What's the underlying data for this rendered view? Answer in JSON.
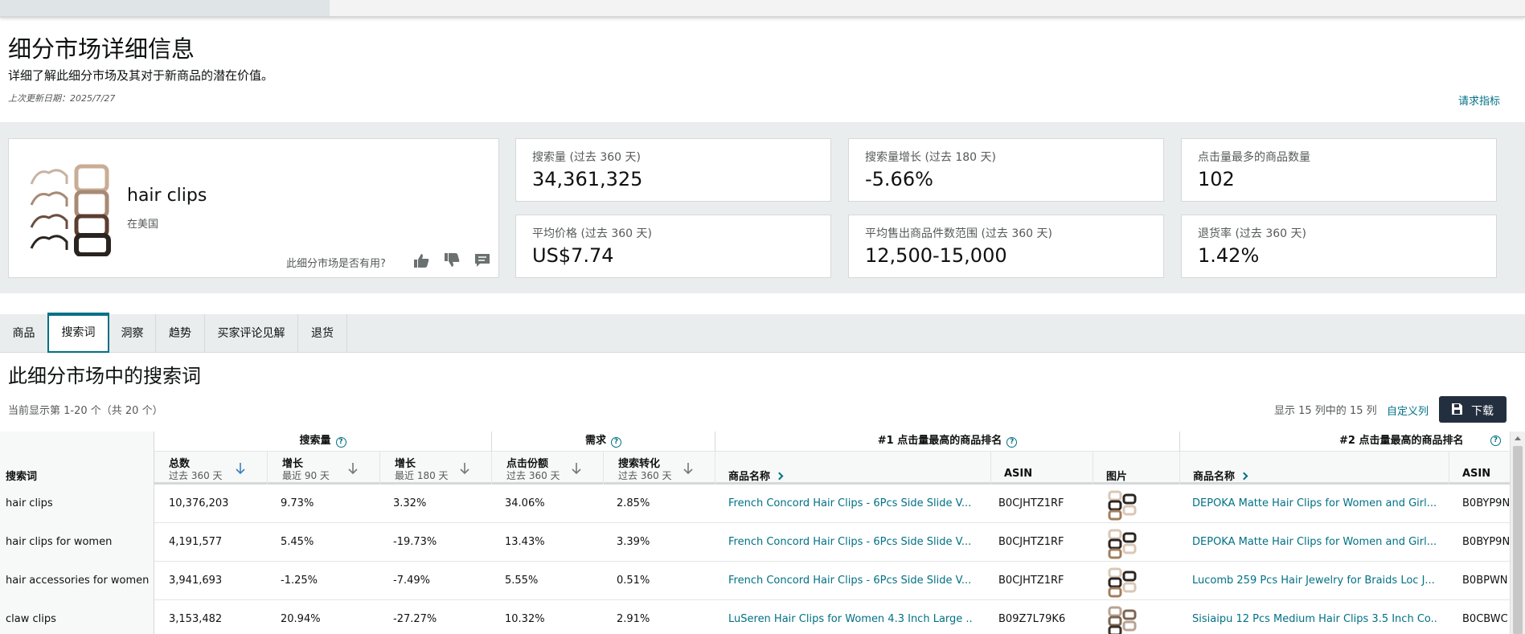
{
  "page": {
    "title": "细分市场详细信息",
    "subtitle": "详细了解此细分市场及其对于新商品的潜在价值。",
    "last_updated": "上次更新日期：2025/7/27",
    "request_metrics": "请求指标"
  },
  "niche": {
    "name": "hair clips",
    "region": "在美国",
    "feedback_question": "此细分市场是否有用?",
    "image_icon": "hair-clips-product-image"
  },
  "metrics": [
    {
      "label": "搜索量 (过去 360 天)",
      "value": "34,361,325"
    },
    {
      "label": "搜索量增长 (过去 180 天)",
      "value": "-5.66%"
    },
    {
      "label": "点击量最多的商品数量",
      "value": "102"
    },
    {
      "label": "平均价格 (过去 360 天)",
      "value": "US$7.74"
    },
    {
      "label": "平均售出商品件数范围 (过去 360 天)",
      "value": "12,500-15,000"
    },
    {
      "label": "退货率 (过去 360 天)",
      "value": "1.42%"
    }
  ],
  "tabs": [
    {
      "label": "商品"
    },
    {
      "label": "搜索词",
      "active": true
    },
    {
      "label": "洞察"
    },
    {
      "label": "趋势"
    },
    {
      "label": "买家评论见解"
    },
    {
      "label": "退货"
    }
  ],
  "section": {
    "title": "此细分市场中的搜索词",
    "showing": "当前显示第 1-20 个（共 20 个）",
    "columns_info": "显示 15 列中的 15 列",
    "custom_columns": "自定义列",
    "download": "下载"
  },
  "table": {
    "groups": {
      "search_volume": "搜索量",
      "demand": "需求",
      "top1": "#1 点击量最高的商品排名",
      "top2": "#2 点击量最高的商品排名"
    },
    "headers": {
      "term": "搜索词",
      "total": "总数",
      "total_sub": "过去 360 天",
      "growth90": "增长",
      "growth90_sub": "最近 90 天",
      "growth180": "增长",
      "growth180_sub": "最近 180 天",
      "click_share": "点击份额",
      "click_share_sub": "过去 360 天",
      "conversion": "搜索转化",
      "conversion_sub": "过去 360 天",
      "product_name": "商品名称",
      "asin": "ASIN",
      "image": "图片",
      "product_name2": "商品名称",
      "asin2": "ASIN"
    },
    "rows": [
      {
        "term": "hair clips",
        "total": "10,376,203",
        "g90": "9.73%",
        "g180": "3.32%",
        "share": "34.06%",
        "conv": "2.85%",
        "p1": "French Concord Hair Clips - 6Pcs Side Slide V...",
        "a1": "B0CJHTZ1RF",
        "p2": "DEPOKA Matte Hair Clips for Women and Girl...",
        "a2": "B0BYP9N"
      },
      {
        "term": "hair clips for women",
        "total": "4,191,577",
        "g90": "5.45%",
        "g180": "-19.73%",
        "share": "13.43%",
        "conv": "3.39%",
        "p1": "French Concord Hair Clips - 6Pcs Side Slide V...",
        "a1": "B0CJHTZ1RF",
        "p2": "DEPOKA Matte Hair Clips for Women and Girl...",
        "a2": "B0BYP9N"
      },
      {
        "term": "hair accessories for women",
        "total": "3,941,693",
        "g90": "-1.25%",
        "g180": "-7.49%",
        "share": "5.55%",
        "conv": "0.51%",
        "p1": "French Concord Hair Clips - 6Pcs Side Slide V...",
        "a1": "B0CJHTZ1RF",
        "p2": "Lucomb 259 Pcs Hair Jewelry for Braids Loc J...",
        "a2": "B0BPWN"
      },
      {
        "term": "claw clips",
        "total": "3,153,482",
        "g90": "20.94%",
        "g180": "-27.27%",
        "share": "10.32%",
        "conv": "2.91%",
        "p1": "LuSeren Hair Clips for Women 4.3 Inch Large ...",
        "a1": "B09Z7L79K6",
        "p2": "Sisiaipu 12 Pcs Medium Hair Clips 3.5 Inch Co...",
        "a2": "B0CBWC"
      }
    ]
  },
  "colors": {
    "link": "#007185",
    "band": "#eaeded",
    "button": "#232f3e"
  }
}
